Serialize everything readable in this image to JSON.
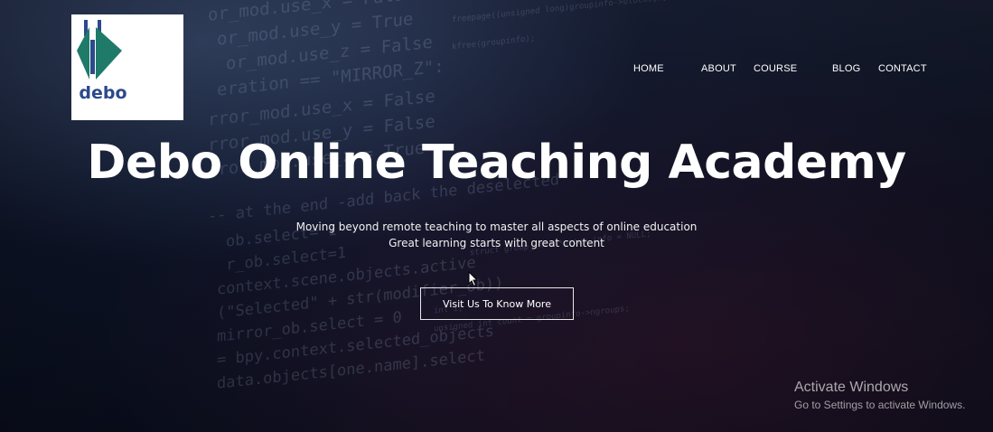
{
  "logo": {
    "text": "debo"
  },
  "nav": {
    "items": [
      {
        "label": "HOME"
      },
      {
        "label": "ABOUT"
      },
      {
        "label": "COURSE"
      },
      {
        "label": "BLOG"
      },
      {
        "label": "CONTACT"
      }
    ]
  },
  "hero": {
    "title": "Debo Online Teaching Academy",
    "subtitle_line1": "Moving beyond remote teaching to master all aspects of online education",
    "subtitle_line2": "Great learning starts with great content",
    "cta_label": "Visit Us To Know More"
  },
  "watermark": {
    "title": "Activate Windows",
    "subtitle": "Go to Settings to activate Windows."
  },
  "colors": {
    "logo_teal": "#1f7a6a",
    "logo_blue": "#2b4a8a",
    "text": "#ffffff"
  }
}
